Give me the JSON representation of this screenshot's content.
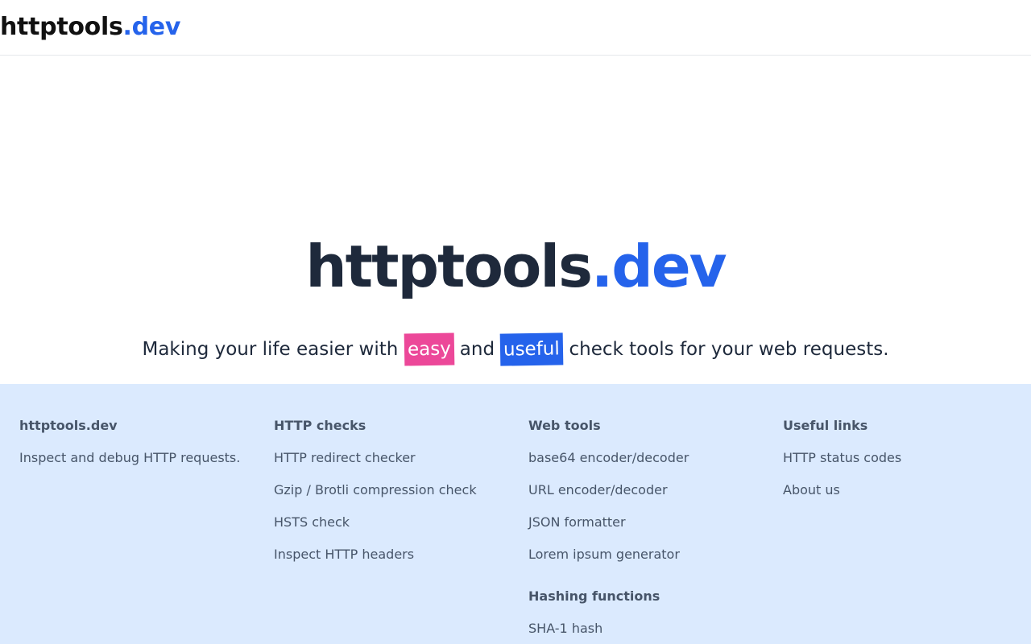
{
  "header": {
    "brand_main": "httptools",
    "brand_suffix": ".dev"
  },
  "hero": {
    "title_main": "httptools",
    "title_suffix": ".dev",
    "tagline_before": "Making your life easier with ",
    "tagline_highlight_1": "easy",
    "tagline_middle": " and ",
    "tagline_highlight_2": "useful",
    "tagline_after": " check tools for your web requests."
  },
  "footer": {
    "about": {
      "heading": "httptools.dev",
      "text": "Inspect and debug HTTP requests."
    },
    "http_checks": {
      "heading": "HTTP checks",
      "items": [
        "HTTP redirect checker",
        "Gzip / Brotli compression check",
        "HSTS check",
        "Inspect HTTP headers"
      ]
    },
    "web_tools": {
      "heading": "Web tools",
      "items": [
        "base64 encoder/decoder",
        "URL encoder/decoder",
        "JSON formatter",
        "Lorem ipsum generator"
      ]
    },
    "hashing": {
      "heading": "Hashing functions",
      "items": [
        "SHA-1 hash"
      ]
    },
    "useful_links": {
      "heading": "Useful links",
      "items": [
        "HTTP status codes",
        "About us"
      ]
    }
  },
  "colors": {
    "accent_blue": "#2563eb",
    "accent_pink": "#ec4899",
    "footer_bg": "#dbeafe",
    "text_dark": "#1e293b",
    "text_muted": "#475569"
  }
}
